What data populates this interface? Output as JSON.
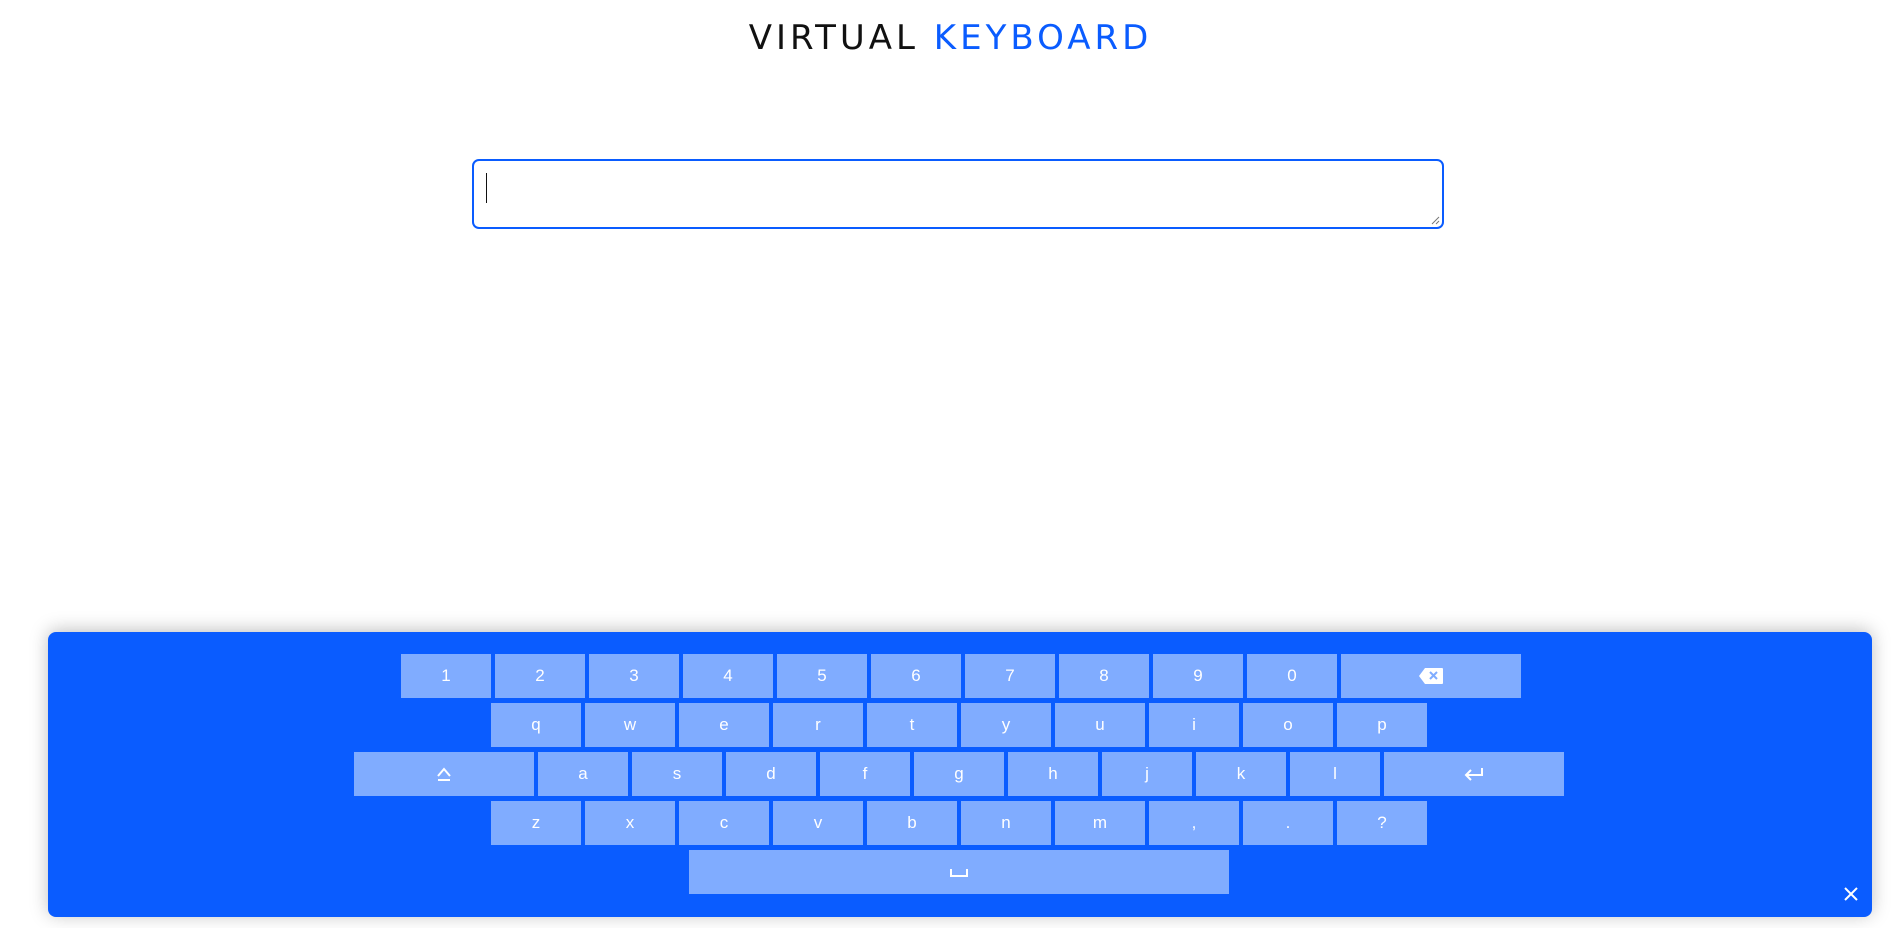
{
  "header": {
    "title_part1": "VIRTUAL",
    "title_part2": "KEYBOARD"
  },
  "input": {
    "value": "",
    "placeholder": ""
  },
  "keyboard": {
    "colors": {
      "panel": "#0a5cff",
      "key": "#80acff",
      "key_text": "#ffffff"
    },
    "rows": [
      [
        {
          "label": "1"
        },
        {
          "label": "2"
        },
        {
          "label": "3"
        },
        {
          "label": "4"
        },
        {
          "label": "5"
        },
        {
          "label": "6"
        },
        {
          "label": "7"
        },
        {
          "label": "8"
        },
        {
          "label": "9"
        },
        {
          "label": "0"
        },
        {
          "label": "",
          "icon": "backspace-icon"
        }
      ],
      [
        {
          "label": "q"
        },
        {
          "label": "w"
        },
        {
          "label": "e"
        },
        {
          "label": "r"
        },
        {
          "label": "t"
        },
        {
          "label": "y"
        },
        {
          "label": "u"
        },
        {
          "label": "i"
        },
        {
          "label": "o"
        },
        {
          "label": "p"
        }
      ],
      [
        {
          "label": "",
          "icon": "shift-icon"
        },
        {
          "label": "a"
        },
        {
          "label": "s"
        },
        {
          "label": "d"
        },
        {
          "label": "f"
        },
        {
          "label": "g"
        },
        {
          "label": "h"
        },
        {
          "label": "j"
        },
        {
          "label": "k"
        },
        {
          "label": "l"
        },
        {
          "label": "",
          "icon": "enter-icon"
        }
      ],
      [
        {
          "label": "z"
        },
        {
          "label": "x"
        },
        {
          "label": "c"
        },
        {
          "label": "v"
        },
        {
          "label": "b"
        },
        {
          "label": "n"
        },
        {
          "label": "m"
        },
        {
          "label": ","
        },
        {
          "label": "."
        },
        {
          "label": "?"
        }
      ],
      [
        {
          "label": "",
          "icon": "space-icon"
        }
      ]
    ],
    "close_icon": "close-icon"
  }
}
